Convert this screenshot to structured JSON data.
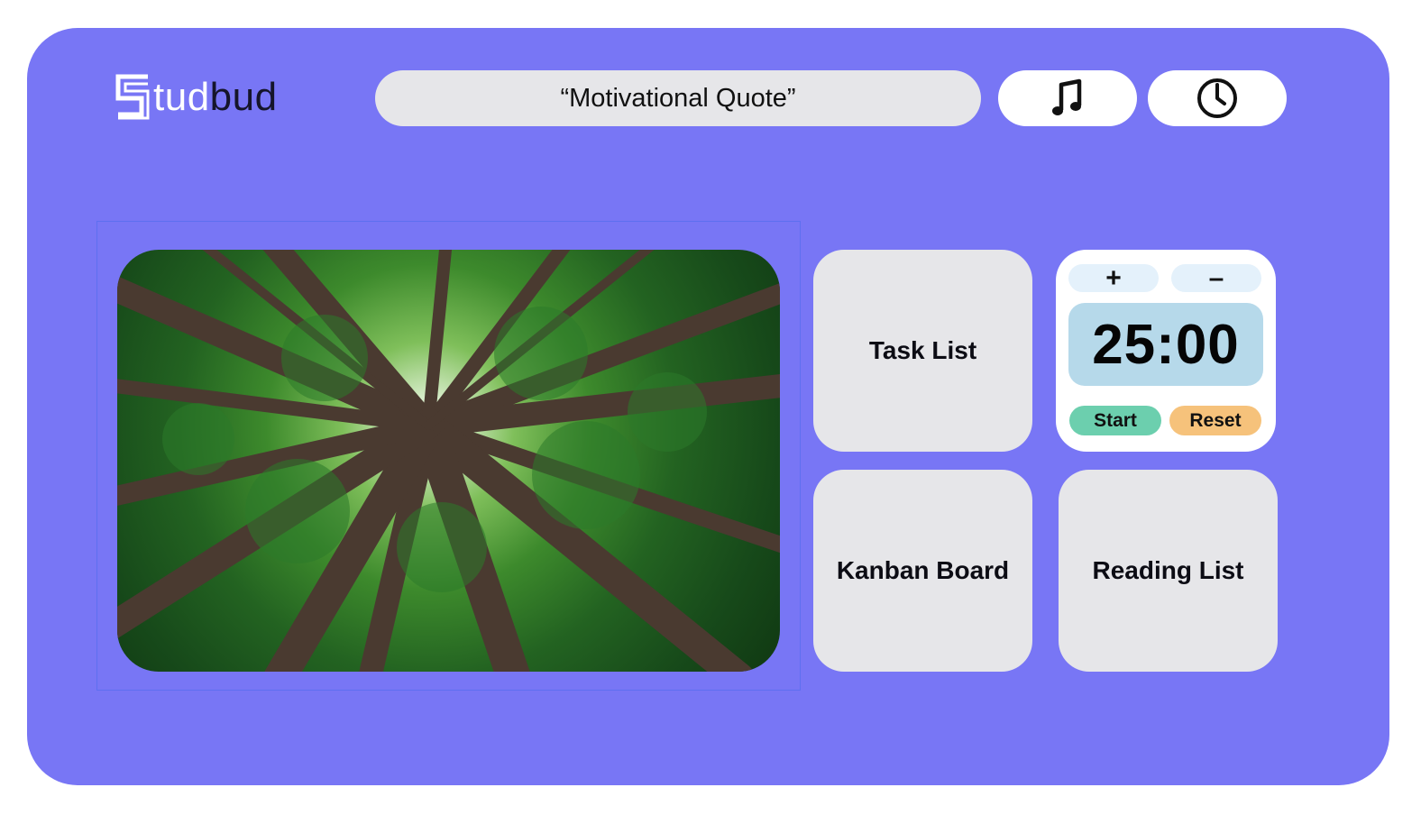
{
  "brand": {
    "logo_text_light": "tud",
    "logo_text_dark": "bud",
    "logo_icon": "studbud-s-logo-icon"
  },
  "header": {
    "quote": "“Motivational Quote”",
    "music_icon": "music-note-icon",
    "clock_icon": "clock-icon"
  },
  "tiles": {
    "task_list": "Task List",
    "kanban_board": "Kanban Board",
    "reading_list": "Reading List"
  },
  "timer": {
    "plus_label": "+",
    "minus_label": "–",
    "time": "25:00",
    "start_label": "Start",
    "reset_label": "Reset"
  },
  "colors": {
    "frame": "#7876f5",
    "tile": "#e6e6e9",
    "timer_display": "#b6d9ea",
    "start": "#6ccfae",
    "reset": "#f6c27b"
  }
}
